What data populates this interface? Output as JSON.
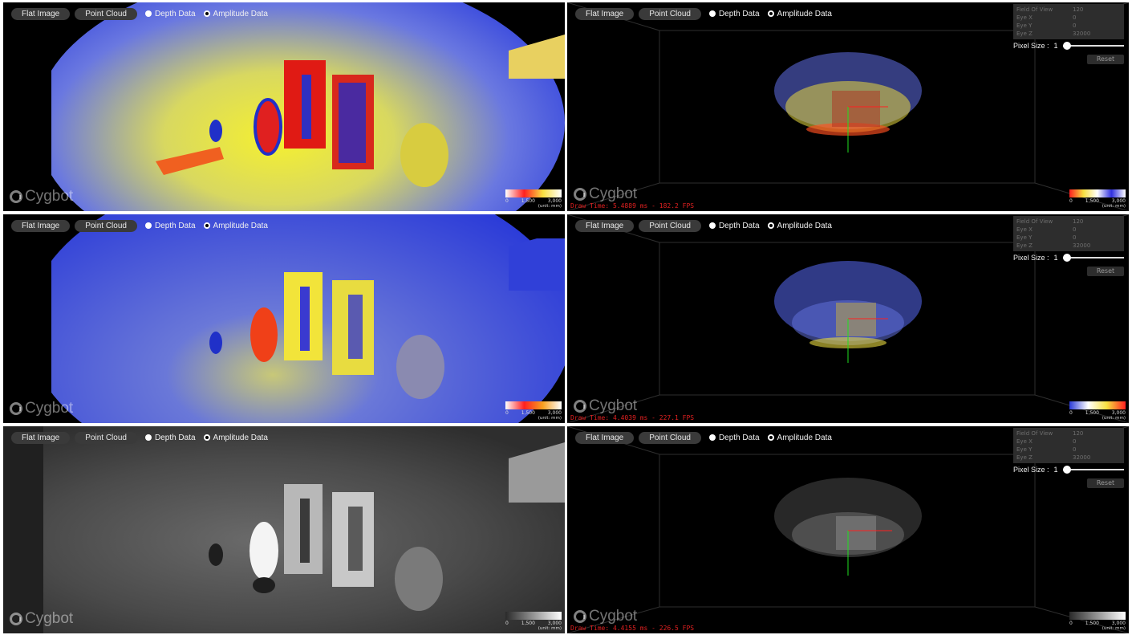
{
  "toolbar": {
    "flat_image": "Flat Image",
    "point_cloud": "Point Cloud",
    "depth_data": "Depth Data",
    "amplitude_data": "Amplitude Data"
  },
  "logo_text": "Cygbot",
  "legend": {
    "ticks": [
      "0",
      "1,500",
      "3,000"
    ],
    "unit": "(unit: mm)"
  },
  "view_controls": {
    "rows": [
      {
        "label": "Field Of View",
        "value": "120"
      },
      {
        "label": "Eye X",
        "value": "0"
      },
      {
        "label": "Eye Y",
        "value": "0"
      },
      {
        "label": "Eye Z",
        "value": "32000"
      }
    ],
    "pixel_size_label": "Pixel Size :",
    "pixel_size_value": "1",
    "reset": "Reset"
  },
  "panels": [
    {
      "mode": "depth-warm",
      "draw_time": ""
    },
    {
      "mode": "depth-warm",
      "draw_time": "Draw Time: 5.4889 ms - 182.2 FPS"
    },
    {
      "mode": "depth-cool",
      "draw_time": ""
    },
    {
      "mode": "depth-cool",
      "draw_time": "Draw Time: 4.4039 ms - 227.1 FPS"
    },
    {
      "mode": "amplitude-gray",
      "draw_time": ""
    },
    {
      "mode": "amplitude-gray",
      "draw_time": "Draw Time: 4.4155 ms - 226.5 FPS"
    }
  ],
  "colors": {
    "ui_pill": "#3a3a3a",
    "draw_time": "#e02020",
    "axis_x": "#ff2020",
    "axis_y": "#20e020",
    "depth_blue": "#2a3ad8",
    "depth_yellow": "#f2e43a",
    "depth_red": "#e81818"
  }
}
